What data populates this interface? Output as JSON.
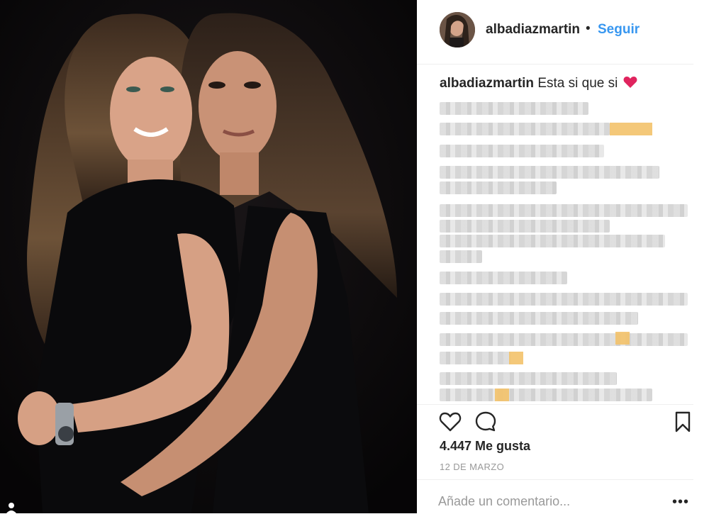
{
  "post": {
    "username": "albadiazmartin",
    "follow_label": "Seguir",
    "separator": "•",
    "caption_user": "albadiazmartin",
    "caption_text": "Esta si que si",
    "likes": "4.447 Me gusta",
    "date": "12 DE MARZO",
    "comment_placeholder": "Añade un comentario...",
    "more_label": "•••"
  },
  "icons": {
    "like": "heart-outline-icon",
    "comment": "speech-bubble-icon",
    "save": "bookmark-icon",
    "caption_emoji": "red-heart-icon",
    "tag": "person-tag-icon"
  },
  "colors": {
    "accent": "#3897f0",
    "text": "#262626",
    "muted": "#999999",
    "heart": "#e0245e"
  }
}
